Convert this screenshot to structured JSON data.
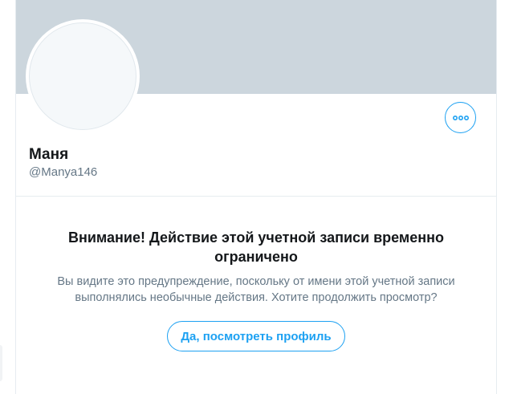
{
  "profile": {
    "name": "Маня",
    "handle": "@Manya146",
    "more_icon": "more-horizontal-icon"
  },
  "warning": {
    "title": "Внимание! Действие этой учетной записи временно ограничено",
    "text": "Вы видите это предупреждение, поскольку от имени этой учетной записи выполнялись необычные действия. Хотите продолжить просмотр?",
    "button_label": "Да, посмотреть профиль"
  },
  "colors": {
    "accent": "#1da1f2",
    "banner": "#ccd6dd",
    "text_primary": "#14171a",
    "text_secondary": "#657786"
  }
}
